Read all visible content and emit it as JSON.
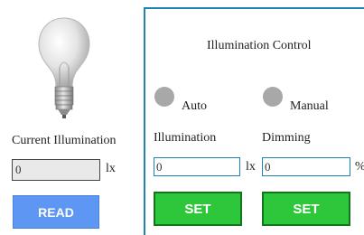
{
  "left": {
    "bulb_icon": "light-bulb-icon",
    "current_label": "Current Illumination",
    "current_value": "0",
    "current_unit": "lx",
    "read_button": "READ"
  },
  "right": {
    "title": "Illumination Control",
    "mode_auto": "Auto",
    "mode_manual": "Manual",
    "illumination_label": "Illumination",
    "illumination_value": "0",
    "illumination_unit": "lx",
    "dimming_label": "Dimming",
    "dimming_value": "0",
    "dimming_unit": "%",
    "set_button_illumination": "SET",
    "set_button_dimming": "SET"
  },
  "colors": {
    "panel_border": "#1c83b9",
    "read_button_bg": "#5e96f4",
    "set_button_bg": "#2ec63a",
    "set_button_border": "#12741c",
    "radio_fill": "#a8a8a8"
  }
}
